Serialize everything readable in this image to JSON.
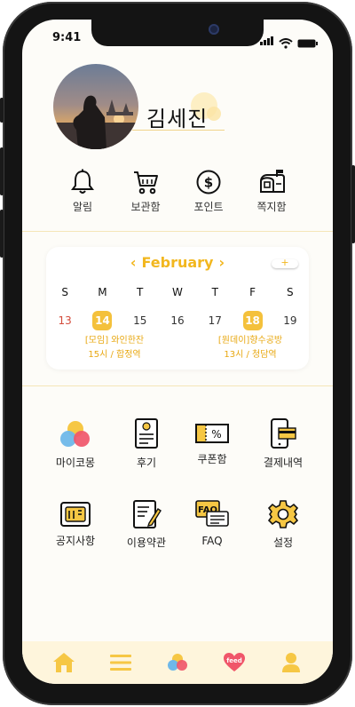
{
  "status_bar": {
    "time": "9:41"
  },
  "profile": {
    "name": "김세진"
  },
  "quick_actions": [
    {
      "label": "알림",
      "icon": "bell-icon"
    },
    {
      "label": "보관함",
      "icon": "cart-icon"
    },
    {
      "label": "포인트",
      "icon": "dollar-coin-icon"
    },
    {
      "label": "쪽지함",
      "icon": "mailbox-icon"
    }
  ],
  "calendar": {
    "month": "February",
    "prev_glyph": "‹",
    "next_glyph": "›",
    "add_glyph": "+",
    "weekdays": [
      "S",
      "M",
      "T",
      "W",
      "T",
      "F",
      "S"
    ],
    "dates": [
      "13",
      "14",
      "15",
      "16",
      "17",
      "18",
      "19"
    ],
    "selected_dates": [
      "14",
      "18"
    ],
    "events": [
      {
        "date": "14",
        "title": "[모임] 와인한잔",
        "detail": "15시 / 합정역"
      },
      {
        "date": "18",
        "title": "[원데이]향수공방",
        "detail": "13시 / 청담역"
      }
    ]
  },
  "menu": [
    {
      "label": "마이코몽",
      "icon": "mycomong-bubbles-icon"
    },
    {
      "label": "후기",
      "icon": "review-document-icon"
    },
    {
      "label": "쿠폰함",
      "icon": "coupon-icon"
    },
    {
      "label": "결제내역",
      "icon": "payment-phone-card-icon"
    },
    {
      "label": "공지사항",
      "icon": "notice-board-icon"
    },
    {
      "label": "이용약관",
      "icon": "terms-document-pen-icon"
    },
    {
      "label": "FAQ",
      "icon": "faq-chat-icon"
    },
    {
      "label": "설정",
      "icon": "settings-gear-icon"
    }
  ],
  "tabbar": {
    "feed_label": "feed",
    "tabs": [
      "home-icon",
      "menu-list-icon",
      "mycomong-icon",
      "feed-heart-icon",
      "profile-icon"
    ]
  },
  "colors": {
    "accent": "#f4c13c",
    "accent_text": "#e8a812",
    "sunday": "#d34b3b",
    "tabbar_bg": "#fef5dc"
  }
}
